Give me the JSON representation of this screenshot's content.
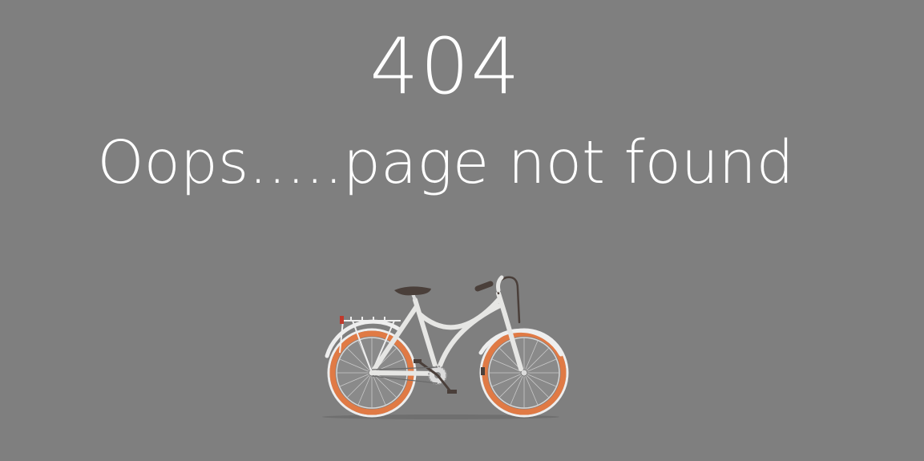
{
  "error": {
    "code": "404",
    "message": "Oops.....page not found"
  },
  "illustration": {
    "name": "bicycle-illustration",
    "colors": {
      "background": "#7f7f7f",
      "frame": "#e6e6e4",
      "tire": "#e07a45",
      "spokes": "#c9c9c9",
      "saddle": "#4a3f3a",
      "shadow": "#6f6f6f"
    }
  }
}
